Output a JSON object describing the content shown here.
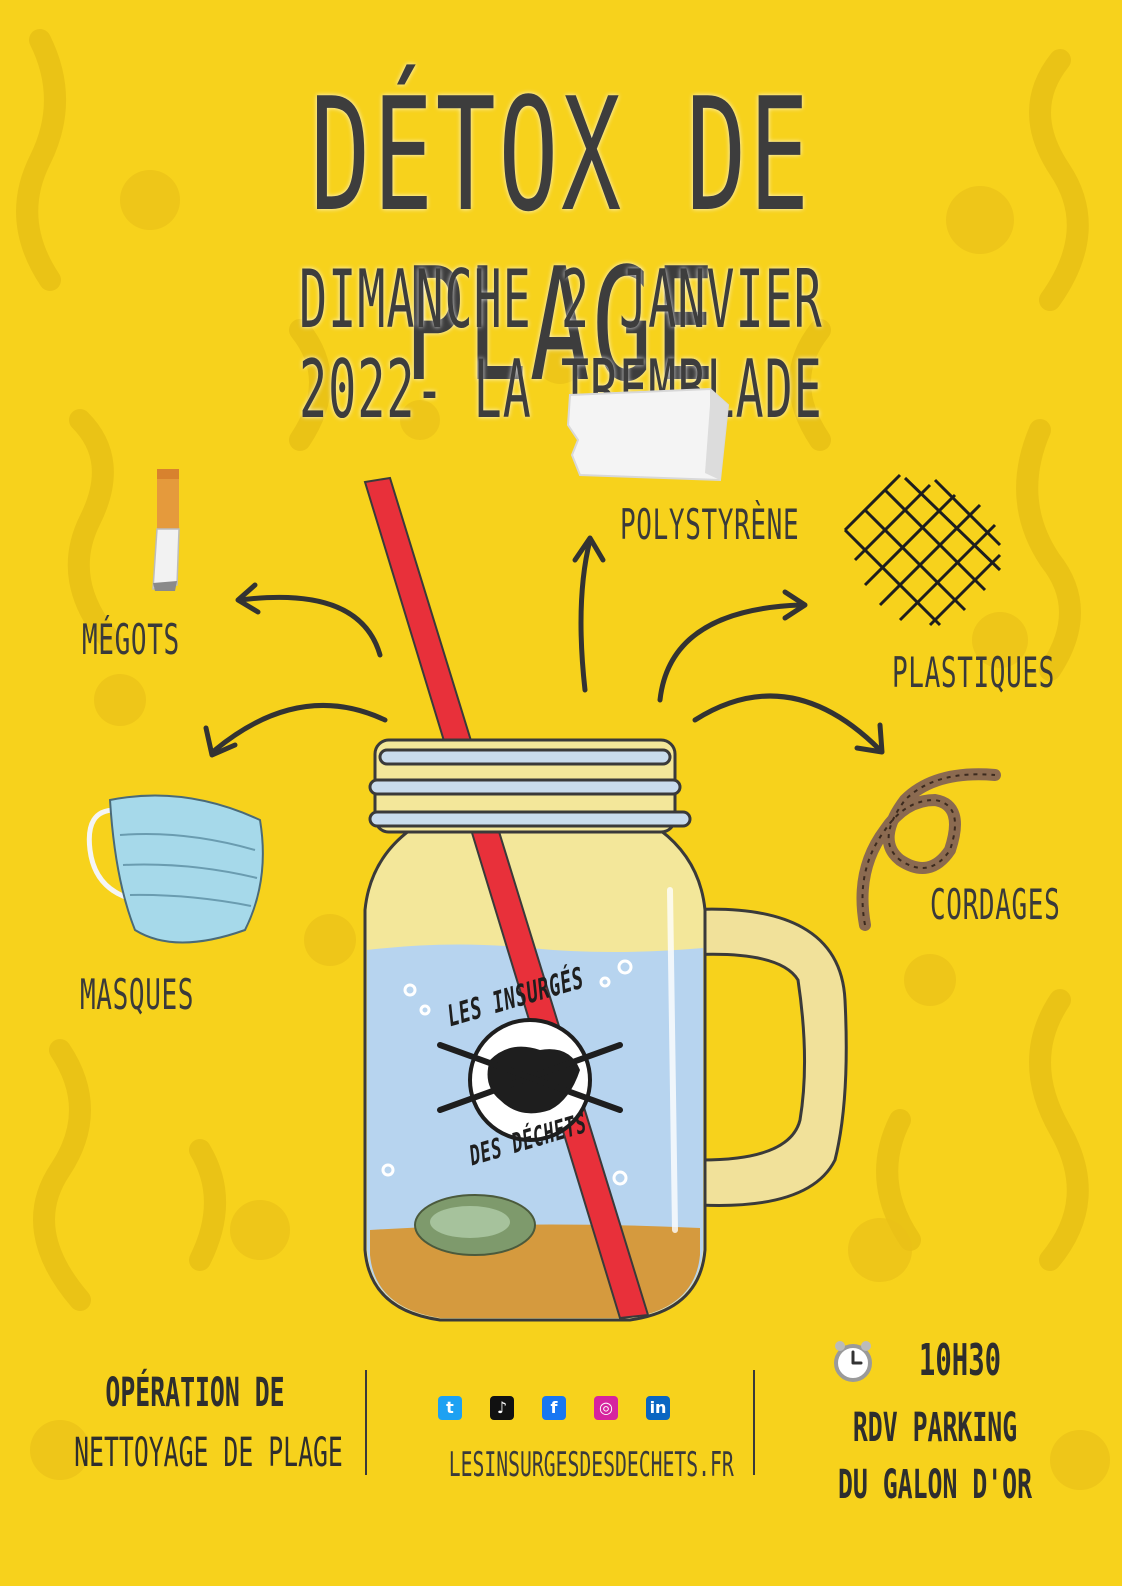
{
  "title": "DÉTOX DE PLAGE",
  "subtitle": "DIMANCHE 2 JANVIER 2022- LA TREMBLADE",
  "items": {
    "polystyrene": "POLYSTYRÈNE",
    "megots": "MÉGOTS",
    "plastiques": "PLASTIQUES",
    "masques": "MASQUES",
    "cordages": "CORDAGES"
  },
  "logo_text": {
    "top": "LES INSURGÉS",
    "bottom": "DES DÉCHETS"
  },
  "footer": {
    "left_line1": "OPÉRATION DE",
    "left_line2": "NETTOYAGE DE PLAGE",
    "website": "LESINSURGESDESDECHETS.FR",
    "time": "10H30",
    "meeting_line1": "RDV PARKING",
    "meeting_line2": "DU GALON D'OR"
  },
  "social_icons": [
    "twitter-icon",
    "tiktok-icon",
    "facebook-icon",
    "instagram-icon",
    "linkedin-icon"
  ],
  "colors": {
    "background": "#f7d21c",
    "text": "#3a3a3a",
    "straw": "#e8303a",
    "water": "#b7d4ef"
  }
}
